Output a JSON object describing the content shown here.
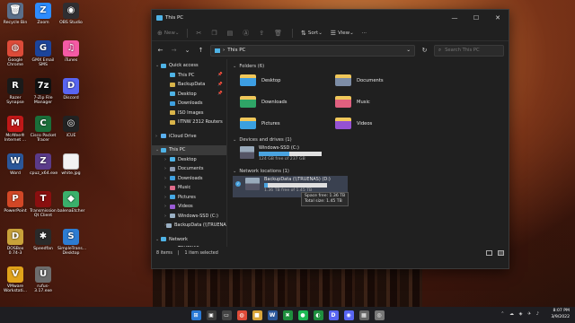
{
  "desktop": {
    "icons": [
      {
        "label": "Recycle Bin",
        "glyph": "🗑",
        "color": "#5a6f8a"
      },
      {
        "label": "Zoom",
        "glyph": "Z",
        "color": "#2d8cff"
      },
      {
        "label": "OBS Studio",
        "glyph": "◉",
        "color": "#302e31"
      },
      {
        "label": "Google Chrome",
        "glyph": "◍",
        "color": "#dd4b39"
      },
      {
        "label": "GMX Email SMS",
        "glyph": "G",
        "color": "#1c449b"
      },
      {
        "label": "iTunes",
        "glyph": "♫",
        "color": "#f45aa4"
      },
      {
        "label": "Razer Synapse",
        "glyph": "R",
        "color": "#1a1a1a"
      },
      {
        "label": "7-Zip File Manager",
        "glyph": "7z",
        "color": "#111111"
      },
      {
        "label": "Discord",
        "glyph": "D",
        "color": "#5865f2"
      },
      {
        "label": "McAfee® Internet ...",
        "glyph": "M",
        "color": "#c01818"
      },
      {
        "label": "Cisco Packet Tracer",
        "glyph": "C",
        "color": "#1a6f3a"
      },
      {
        "label": "iCUE",
        "glyph": "◎",
        "color": "#222222"
      },
      {
        "label": "Word",
        "glyph": "W",
        "color": "#2b579a"
      },
      {
        "label": "cpuz_x64.exe",
        "glyph": "Z",
        "color": "#5b3b8a"
      },
      {
        "label": "white.jpg",
        "glyph": "",
        "color": "#f2f2f2"
      },
      {
        "label": "PowerPoint",
        "glyph": "P",
        "color": "#d24726"
      },
      {
        "label": "Transmission Qt Client",
        "glyph": "T",
        "color": "#8a0f0f"
      },
      {
        "label": "balenaEtcher",
        "glyph": "◆",
        "color": "#3ab06b"
      },
      {
        "label": "DOSBox 0.74-3",
        "glyph": "D",
        "color": "#c8a23a"
      },
      {
        "label": "Speedfan",
        "glyph": "✱",
        "color": "#2a2a2a"
      },
      {
        "label": "SimpleTrans... Desktop",
        "glyph": "S",
        "color": "#2d7cd1"
      },
      {
        "label": "VMware Workstati...",
        "glyph": "V",
        "color": "#e1a31a"
      },
      {
        "label": "rufus-3.17.exe",
        "glyph": "U",
        "color": "#6d6d6d"
      }
    ]
  },
  "window": {
    "title": "This PC",
    "commands": {
      "new": "New",
      "sort": "Sort",
      "view": "View",
      "more": "···"
    },
    "address": {
      "crumb": "This PC"
    },
    "search": {
      "placeholder": "Search This PC"
    },
    "nav": [
      {
        "label": "Quick access",
        "chev": "⌄",
        "color": "#4fb3e6",
        "pin": "",
        "sel": false
      },
      {
        "label": "This PC",
        "chev": "",
        "color": "#4fb3e6",
        "pin": "📌",
        "sel": false
      },
      {
        "label": "BackupData",
        "chev": "",
        "color": "#d9b44a",
        "pin": "📌",
        "sel": false
      },
      {
        "label": "Desktop",
        "chev": "",
        "color": "#4fb3e6",
        "pin": "📌",
        "sel": false
      },
      {
        "label": "Downloads",
        "chev": "",
        "color": "#3fa0e0",
        "pin": "",
        "sel": false
      },
      {
        "label": "ISO Images",
        "chev": "",
        "color": "#d9b44a",
        "pin": "",
        "sel": false
      },
      {
        "label": "IITNW 2312 Routers",
        "chev": "",
        "color": "#d9b44a",
        "pin": "",
        "sel": false
      },
      {
        "label": "",
        "chev": "",
        "color": "",
        "pin": "",
        "sel": false
      },
      {
        "label": "iCloud Drive",
        "chev": "›",
        "color": "#5ab0ef",
        "pin": "",
        "sel": false
      },
      {
        "label": "",
        "chev": "",
        "color": "",
        "pin": "",
        "sel": false
      },
      {
        "label": "This PC",
        "chev": "⌄",
        "color": "#4fb3e6",
        "pin": "",
        "sel": true
      },
      {
        "label": "Desktop",
        "chev": "›",
        "color": "#4fb3e6",
        "pin": "",
        "sel": false
      },
      {
        "label": "Documents",
        "chev": "›",
        "color": "#8d9ab0",
        "pin": "",
        "sel": false
      },
      {
        "label": "Downloads",
        "chev": "›",
        "color": "#3fa0e0",
        "pin": "",
        "sel": false
      },
      {
        "label": "Music",
        "chev": "›",
        "color": "#e06b8a",
        "pin": "",
        "sel": false
      },
      {
        "label": "Pictures",
        "chev": "›",
        "color": "#46a8e3",
        "pin": "",
        "sel": false
      },
      {
        "label": "Videos",
        "chev": "›",
        "color": "#9a5bd6",
        "pin": "",
        "sel": false
      },
      {
        "label": "Windows-SSD (C:)",
        "chev": "›",
        "color": "#9ab0c4",
        "pin": "",
        "sel": false
      },
      {
        "label": "BackupData (\\\\TRUENAS) (D:)",
        "chev": "›",
        "color": "#9ab0c4",
        "pin": "",
        "sel": false
      },
      {
        "label": "",
        "chev": "",
        "color": "",
        "pin": "",
        "sel": false
      },
      {
        "label": "Network",
        "chev": "⌄",
        "color": "#4fb3e6",
        "pin": "",
        "sel": false
      },
      {
        "label": "TRUENAS",
        "chev": "›",
        "color": "#9ab0c4",
        "pin": "",
        "sel": false
      }
    ],
    "sections": {
      "folders": "Folders (6)",
      "drives": "Devices and drives (1)",
      "network": "Network locations (1)"
    },
    "folders": [
      {
        "label": "Desktop",
        "color": "#3d9ee3"
      },
      {
        "label": "Documents",
        "color": "#7d8da6"
      },
      {
        "label": "Downloads",
        "color": "#2fa566"
      },
      {
        "label": "Music",
        "color": "#e0607f"
      },
      {
        "label": "Pictures",
        "color": "#3aa0e0"
      },
      {
        "label": "Videos",
        "color": "#9552d2"
      }
    ],
    "drives": [
      {
        "name": "Windows-SSD (C:)",
        "free": "124 GB free of 237 GB",
        "used_fraction": 0.48,
        "sel": false
      }
    ],
    "network": [
      {
        "name": "BackupData (\\\\TRUENAS) (D:)",
        "free": "1.36 TB free of 1.45 TB",
        "used_fraction": 0.06,
        "sel": true
      }
    ],
    "tooltip": {
      "line1": "Space free: 1.36 TB",
      "line2": "Total size: 1.45 TB"
    },
    "status": {
      "items": "8 items",
      "selected": "1 item selected"
    }
  },
  "taskbar": {
    "apps": [
      {
        "glyph": "⊞",
        "color": "#2a7ad6"
      },
      {
        "glyph": "▣",
        "color": "#3b3b3b"
      },
      {
        "glyph": "▭",
        "color": "#444444"
      },
      {
        "glyph": "◍",
        "color": "#dd4b39"
      },
      {
        "glyph": "■",
        "color": "#d9a53a"
      },
      {
        "glyph": "W",
        "color": "#2b579a"
      },
      {
        "glyph": "✖",
        "color": "#1e8e3e"
      },
      {
        "glyph": "●",
        "color": "#1db954"
      },
      {
        "glyph": "◐",
        "color": "#1e8e3e"
      },
      {
        "glyph": "D",
        "color": "#5865f2"
      },
      {
        "glyph": "◉",
        "color": "#5865f2"
      },
      {
        "glyph": "▦",
        "color": "#666666"
      },
      {
        "glyph": "◎",
        "color": "#777777"
      }
    ],
    "time": "8:07 PM",
    "date": "3/9/2022",
    "tray": "⌃ ☁ ◈ ✈ ♪"
  }
}
